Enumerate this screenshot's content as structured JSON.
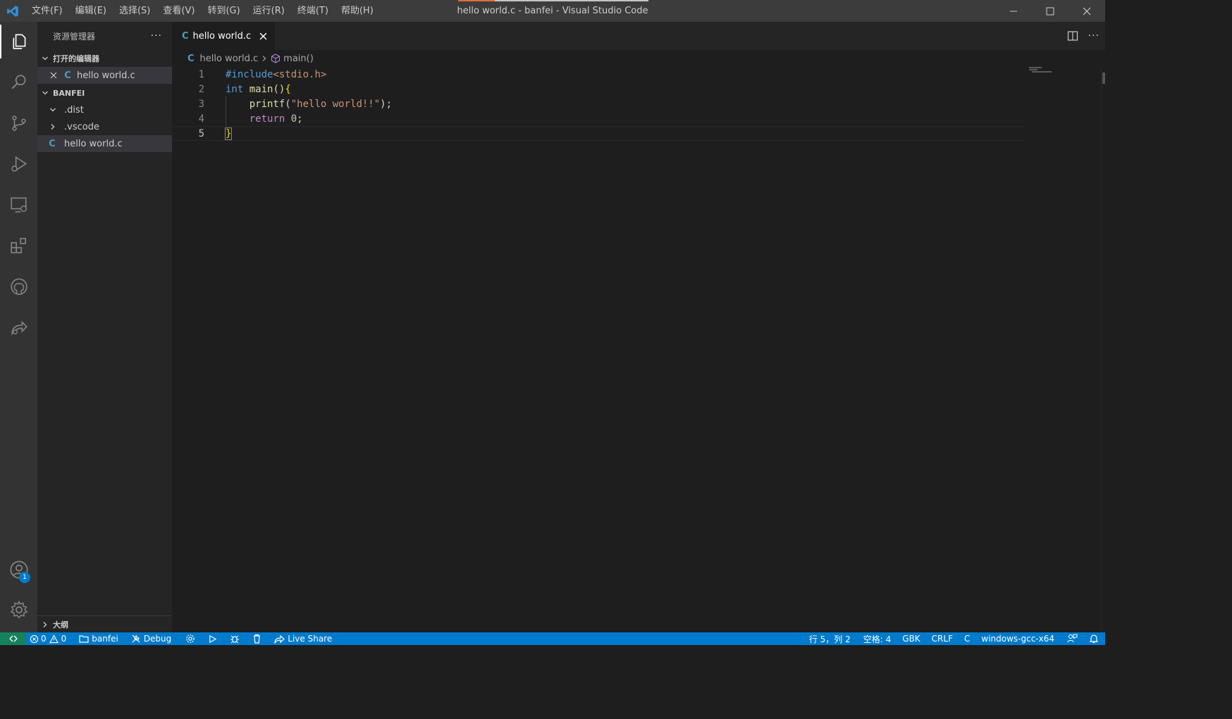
{
  "titlebar": {
    "app_icon": "vscode-logo-icon",
    "menu": [
      "文件(F)",
      "编辑(E)",
      "选择(S)",
      "查看(V)",
      "转到(G)",
      "运行(R)",
      "终端(T)",
      "帮助(H)"
    ],
    "window_title": "hello world.c - banfei - Visual Studio Code",
    "controls": [
      "minimize-icon",
      "maximize-icon",
      "close-icon"
    ]
  },
  "activitybar": {
    "items": [
      "explorer-icon",
      "search-icon",
      "source-control-icon",
      "run-debug-icon",
      "remote-explorer-icon",
      "extensions-icon",
      "github-icon",
      "live-share-icon"
    ],
    "bottom": [
      "accounts-icon",
      "manage-gear-icon"
    ],
    "accounts_badge": "1"
  },
  "sidebar": {
    "title": "资源管理器",
    "more": "···",
    "open_editors": {
      "header": "打开的编辑器",
      "items": [
        {
          "icon": "C",
          "name": "hello world.c"
        }
      ]
    },
    "folder": {
      "header": "BANFEI",
      "items": [
        {
          "name": ".dist",
          "expanded": true
        },
        {
          "name": ".vscode",
          "expanded": false
        },
        {
          "icon": "C",
          "name": "hello world.c"
        }
      ]
    },
    "outline": {
      "header": "大纲"
    }
  },
  "editor": {
    "tab": {
      "icon": "C",
      "label": "hello world.c"
    },
    "breadcrumb": {
      "file_icon": "C",
      "file": "hello world.c",
      "symbol": "main()"
    },
    "line_numbers": [
      "1",
      "2",
      "3",
      "4",
      "5"
    ],
    "code": {
      "l1": {
        "pre": "#include",
        "inc": "<stdio.h>"
      },
      "l2": {
        "kw": "int",
        "fn": " main()",
        "brace": "{"
      },
      "l3": {
        "indent": "    ",
        "fn": "printf",
        "open": "(",
        "str": "\"hello world!!\"",
        "close": ");"
      },
      "l4": {
        "indent": "    ",
        "ctl": "return",
        "sp": " ",
        "num": "0",
        "semi": ";"
      },
      "l5": {
        "brace": "}"
      }
    }
  },
  "statusbar": {
    "errors": "0",
    "warnings": "0",
    "folder": "banfei",
    "build_config": "Debug",
    "live_share": "Live Share",
    "position": "行 5，列 2",
    "indent": "空格: 4",
    "encoding": "GBK",
    "eol": "CRLF",
    "language": "C",
    "compiler": "windows-gcc-x64"
  }
}
